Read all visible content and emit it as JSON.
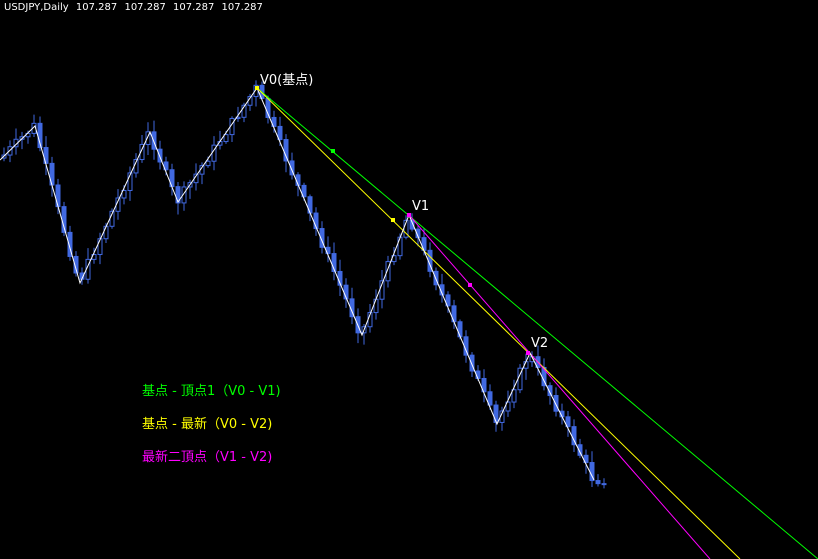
{
  "header": {
    "symbol": "USDJPY,Daily",
    "ohlc": [
      "107.287",
      "107.287",
      "107.287",
      "107.287"
    ]
  },
  "colors": {
    "background": "#000000",
    "candle": "#4169e1",
    "zigzag": "#ffffff",
    "line_v0_v1": "#00ff00",
    "line_v0_v2": "#ffff00",
    "line_v1_v2": "#ff00ff"
  },
  "chart_data": {
    "type": "candlestick",
    "series": [
      {
        "name": "USDJPY,Daily",
        "kind": "candlestick"
      },
      {
        "name": "zigzag",
        "kind": "line"
      }
    ],
    "points": [
      {
        "id": "V0",
        "label": "V0(基点)"
      },
      {
        "id": "V1",
        "label": "V1"
      },
      {
        "id": "V2",
        "label": "V2"
      }
    ],
    "legend": [
      {
        "text": "基点 - 頂点1（V0 - V1)",
        "color": "#00ff00"
      },
      {
        "text": "基点 - 最新（V0 - V2)",
        "color": "#ffff00"
      },
      {
        "text": "最新二頂点（V1 - V2)",
        "color": "#ff00ff"
      }
    ]
  }
}
